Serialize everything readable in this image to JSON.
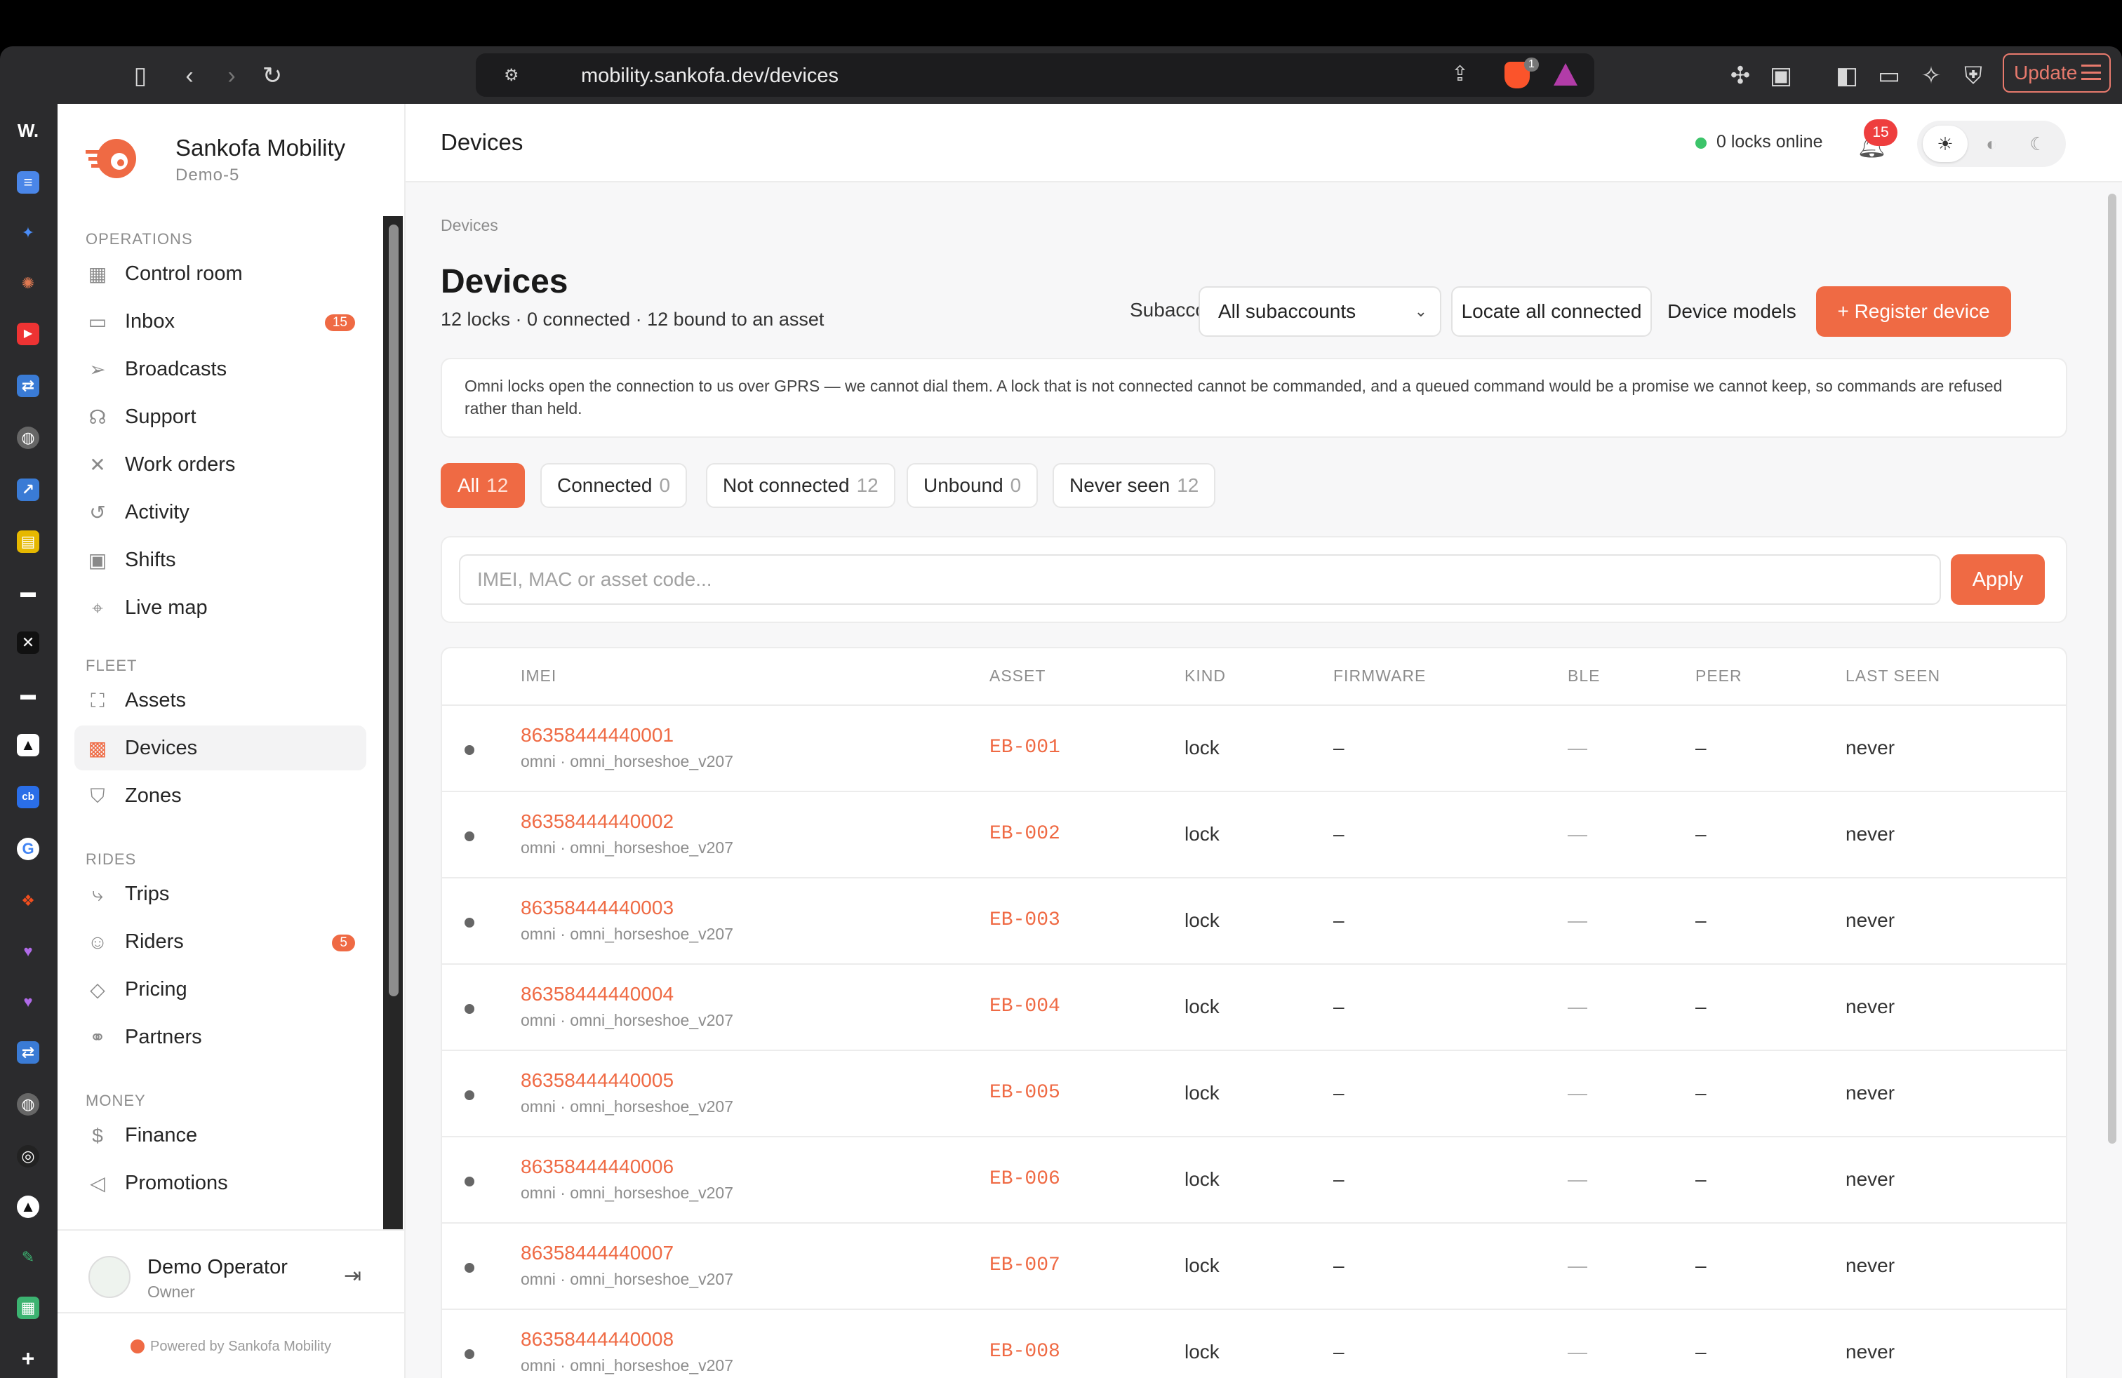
{
  "browser": {
    "url": "mobility.sankofa.dev/devices",
    "extension_count": "1",
    "update_label": "Update"
  },
  "brand": {
    "name": "Sankofa Mobility",
    "subtitle": "Demo-5"
  },
  "sidebar": {
    "sections": [
      {
        "title": "OPERATIONS",
        "items": [
          {
            "label": "Control room",
            "icon": "grid-icon"
          },
          {
            "label": "Inbox",
            "icon": "inbox-icon",
            "badge": "15"
          },
          {
            "label": "Broadcasts",
            "icon": "send-icon"
          },
          {
            "label": "Support",
            "icon": "headset-icon"
          },
          {
            "label": "Work orders",
            "icon": "tools-icon"
          },
          {
            "label": "Activity",
            "icon": "history-icon"
          },
          {
            "label": "Shifts",
            "icon": "calendar-icon"
          },
          {
            "label": "Live map",
            "icon": "pin-icon"
          }
        ]
      },
      {
        "title": "FLEET",
        "items": [
          {
            "label": "Assets",
            "icon": "bike-icon"
          },
          {
            "label": "Devices",
            "icon": "chip-icon",
            "active": true
          },
          {
            "label": "Zones",
            "icon": "shield-icon"
          }
        ]
      },
      {
        "title": "RIDES",
        "items": [
          {
            "label": "Trips",
            "icon": "route-icon"
          },
          {
            "label": "Riders",
            "icon": "user-icon",
            "badge": "5"
          },
          {
            "label": "Pricing",
            "icon": "tag-icon"
          },
          {
            "label": "Partners",
            "icon": "handshake-icon"
          }
        ]
      },
      {
        "title": "MONEY",
        "items": [
          {
            "label": "Finance",
            "icon": "dollar-icon"
          },
          {
            "label": "Promotions",
            "icon": "megaphone-icon"
          }
        ]
      }
    ],
    "user": {
      "name": "Demo Operator",
      "role": "Owner"
    },
    "powered_by": "Powered by Sankofa Mobility"
  },
  "header": {
    "title": "Devices",
    "status": "0 locks online",
    "notifications": "15"
  },
  "page": {
    "breadcrumb": "Devices",
    "title": "Devices",
    "subtitle": "12 locks · 0 connected · 12 bound to an asset",
    "subaccount_label": "Subaccount",
    "subaccount_value": "All subaccounts",
    "locate_label": "Locate all connected",
    "models_label": "Device models",
    "register_label": "+ Register device",
    "notice": "Omni locks open the connection to us over GPRS — we cannot dial them. A lock that is not connected cannot be commanded, and a queued command would be a promise we cannot keep, so commands are refused rather than held.",
    "filters": [
      {
        "label": "All",
        "count": "12",
        "active": true
      },
      {
        "label": "Connected",
        "count": "0"
      },
      {
        "label": "Not connected",
        "count": "12"
      },
      {
        "label": "Unbound",
        "count": "0"
      },
      {
        "label": "Never seen",
        "count": "12"
      }
    ],
    "search_placeholder": "IMEI, MAC or asset code...",
    "apply_label": "Apply"
  },
  "table": {
    "columns": [
      "IMEI",
      "ASSET",
      "KIND",
      "FIRMWARE",
      "BLE",
      "PEER",
      "LAST SEEN"
    ],
    "rows": [
      {
        "imei": "86358444440001",
        "model": "omni · omni_horseshoe_v207",
        "asset": "EB-001",
        "kind": "lock",
        "firmware": "–",
        "ble": "—",
        "peer": "–",
        "last_seen": "never"
      },
      {
        "imei": "86358444440002",
        "model": "omni · omni_horseshoe_v207",
        "asset": "EB-002",
        "kind": "lock",
        "firmware": "–",
        "ble": "—",
        "peer": "–",
        "last_seen": "never"
      },
      {
        "imei": "86358444440003",
        "model": "omni · omni_horseshoe_v207",
        "asset": "EB-003",
        "kind": "lock",
        "firmware": "–",
        "ble": "—",
        "peer": "–",
        "last_seen": "never"
      },
      {
        "imei": "86358444440004",
        "model": "omni · omni_horseshoe_v207",
        "asset": "EB-004",
        "kind": "lock",
        "firmware": "–",
        "ble": "—",
        "peer": "–",
        "last_seen": "never"
      },
      {
        "imei": "86358444440005",
        "model": "omni · omni_horseshoe_v207",
        "asset": "EB-005",
        "kind": "lock",
        "firmware": "–",
        "ble": "—",
        "peer": "–",
        "last_seen": "never"
      },
      {
        "imei": "86358444440006",
        "model": "omni · omni_horseshoe_v207",
        "asset": "EB-006",
        "kind": "lock",
        "firmware": "–",
        "ble": "—",
        "peer": "–",
        "last_seen": "never"
      },
      {
        "imei": "86358444440007",
        "model": "omni · omni_horseshoe_v207",
        "asset": "EB-007",
        "kind": "lock",
        "firmware": "–",
        "ble": "—",
        "peer": "–",
        "last_seen": "never"
      },
      {
        "imei": "86358444440008",
        "model": "omni · omni_horseshoe_v207",
        "asset": "EB-008",
        "kind": "lock",
        "firmware": "–",
        "ble": "—",
        "peer": "–",
        "last_seen": "never"
      }
    ]
  },
  "colors": {
    "accent": "#ef6a44",
    "online": "#3cc46a",
    "badge": "#ee3e3e"
  }
}
